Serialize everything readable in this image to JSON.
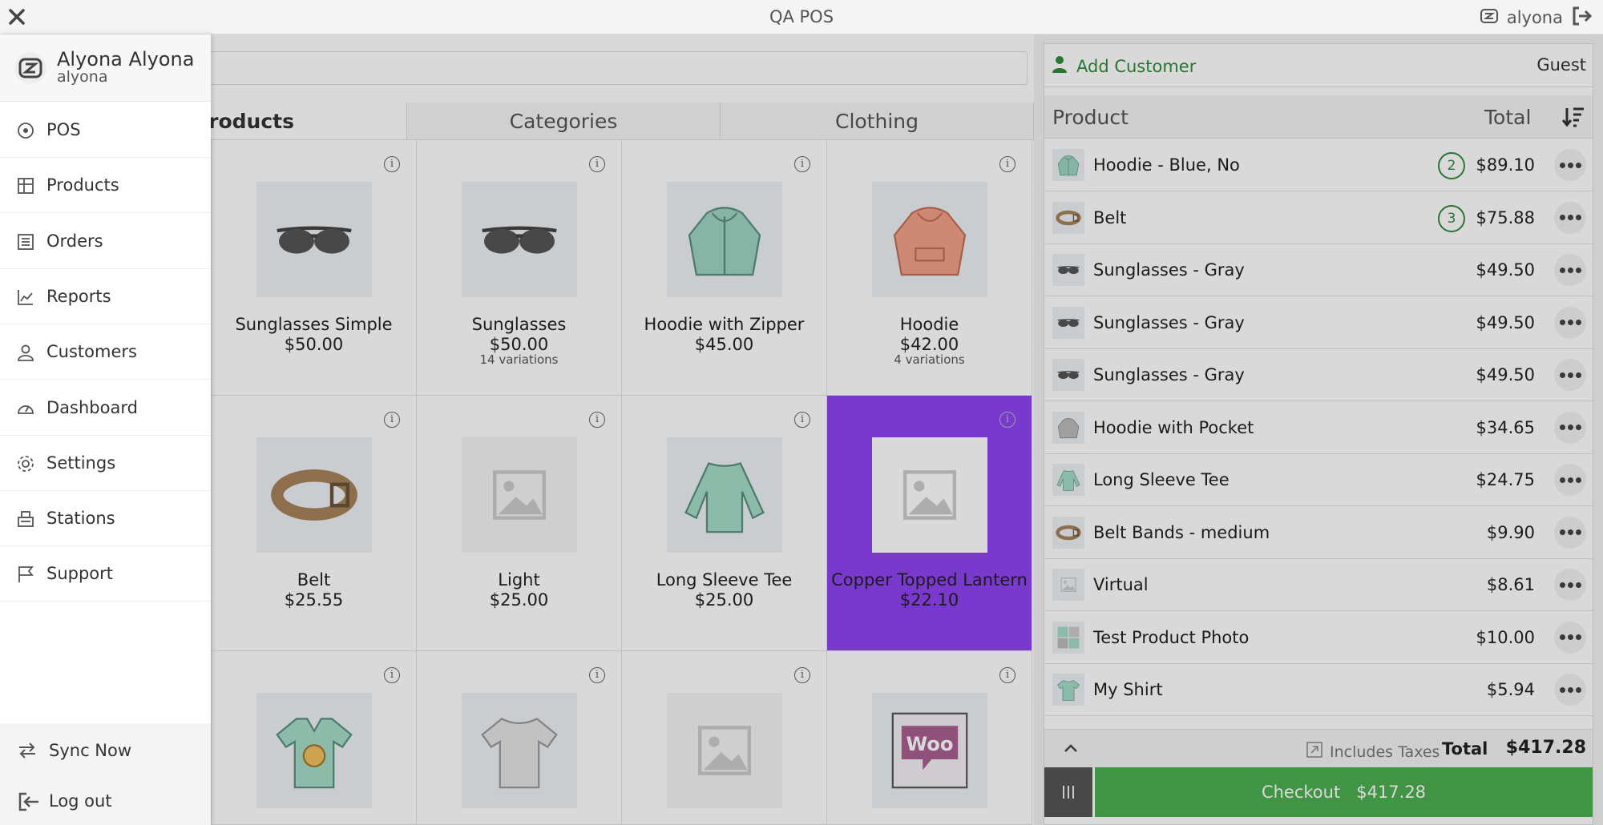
{
  "app": {
    "title": "QA POS",
    "username": "alyona"
  },
  "drawer": {
    "user_name": "Alyona Alyona",
    "user_login": "alyona",
    "nav": [
      {
        "label": "POS",
        "icon": "pos-icon"
      },
      {
        "label": "Products",
        "icon": "products-icon"
      },
      {
        "label": "Orders",
        "icon": "orders-icon"
      },
      {
        "label": "Reports",
        "icon": "reports-icon"
      },
      {
        "label": "Customers",
        "icon": "customers-icon"
      },
      {
        "label": "Dashboard",
        "icon": "dashboard-icon"
      },
      {
        "label": "Settings",
        "icon": "settings-icon"
      },
      {
        "label": "Stations",
        "icon": "stations-icon"
      },
      {
        "label": "Support",
        "icon": "support-icon"
      }
    ],
    "sync_label": "Sync Now",
    "logout_label": "Log out"
  },
  "tabs": [
    "Products",
    "Categories",
    "Clothing"
  ],
  "products": [
    {
      "name": "Sunglasses Simple",
      "price": "$50.00",
      "variations": "",
      "image": "sunglasses"
    },
    {
      "name": "Sunglasses",
      "price": "$50.00",
      "variations": "14 variations",
      "image": "sunglasses"
    },
    {
      "name": "Hoodie with Zipper",
      "price": "$45.00",
      "variations": "",
      "image": "hoodie-zipper"
    },
    {
      "name": "Hoodie",
      "price": "$42.00",
      "variations": "4 variations",
      "image": "hoodie"
    },
    {
      "name": "Belt",
      "price": "$25.55",
      "variations": "",
      "image": "belt"
    },
    {
      "name": "Light",
      "price": "$25.00",
      "variations": "",
      "image": "placeholder"
    },
    {
      "name": "Long Sleeve Tee",
      "price": "$25.00",
      "variations": "",
      "image": "longsleeve"
    },
    {
      "name": "Copper Topped Lantern",
      "price": "$22.10",
      "variations": "",
      "image": "placeholder",
      "selected": true
    },
    {
      "name": "",
      "price": "",
      "variations": "",
      "image": "vneck"
    },
    {
      "name": "",
      "price": "",
      "variations": "",
      "image": "tshirt"
    },
    {
      "name": "",
      "price": "",
      "variations": "",
      "image": "placeholder"
    },
    {
      "name": "",
      "price": "",
      "variations": "",
      "image": "album"
    }
  ],
  "cart": {
    "add_customer_label": "Add Customer",
    "customer": "Guest",
    "col_product": "Product",
    "col_total": "Total",
    "items": [
      {
        "name": "Hoodie - Blue, No",
        "qty": "2",
        "price": "$89.10",
        "image": "hoodie-zipper"
      },
      {
        "name": "Belt",
        "qty": "3",
        "price": "$75.88",
        "image": "belt"
      },
      {
        "name": "Sunglasses - Gray",
        "qty": "",
        "price": "$49.50",
        "image": "sunglasses"
      },
      {
        "name": "Sunglasses - Gray",
        "qty": "",
        "price": "$49.50",
        "image": "sunglasses"
      },
      {
        "name": "Sunglasses - Gray",
        "qty": "",
        "price": "$49.50",
        "image": "sunglasses"
      },
      {
        "name": "Hoodie with Pocket",
        "qty": "",
        "price": "$34.65",
        "image": "hoodie-gray"
      },
      {
        "name": "Long Sleeve Tee",
        "qty": "",
        "price": "$24.75",
        "image": "longsleeve"
      },
      {
        "name": "Belt Bands - medium",
        "qty": "",
        "price": "$9.90",
        "image": "belt"
      },
      {
        "name": "Virtual",
        "qty": "",
        "price": "$8.61",
        "image": "placeholder"
      },
      {
        "name": "Test Product Photo",
        "qty": "",
        "price": "$10.00",
        "image": "photo"
      },
      {
        "name": "My Shirt",
        "qty": "",
        "price": "$5.94",
        "image": "tshirt-green"
      }
    ],
    "includes_taxes": "Includes Taxes",
    "total_label": "Total",
    "total_value": "$417.28",
    "checkout_label": "Checkout",
    "checkout_amount": "$417.28"
  },
  "colors": {
    "accent_green": "#2e8b3a",
    "checkout_green": "#4caf50",
    "selected_purple": "#8e44f0"
  }
}
